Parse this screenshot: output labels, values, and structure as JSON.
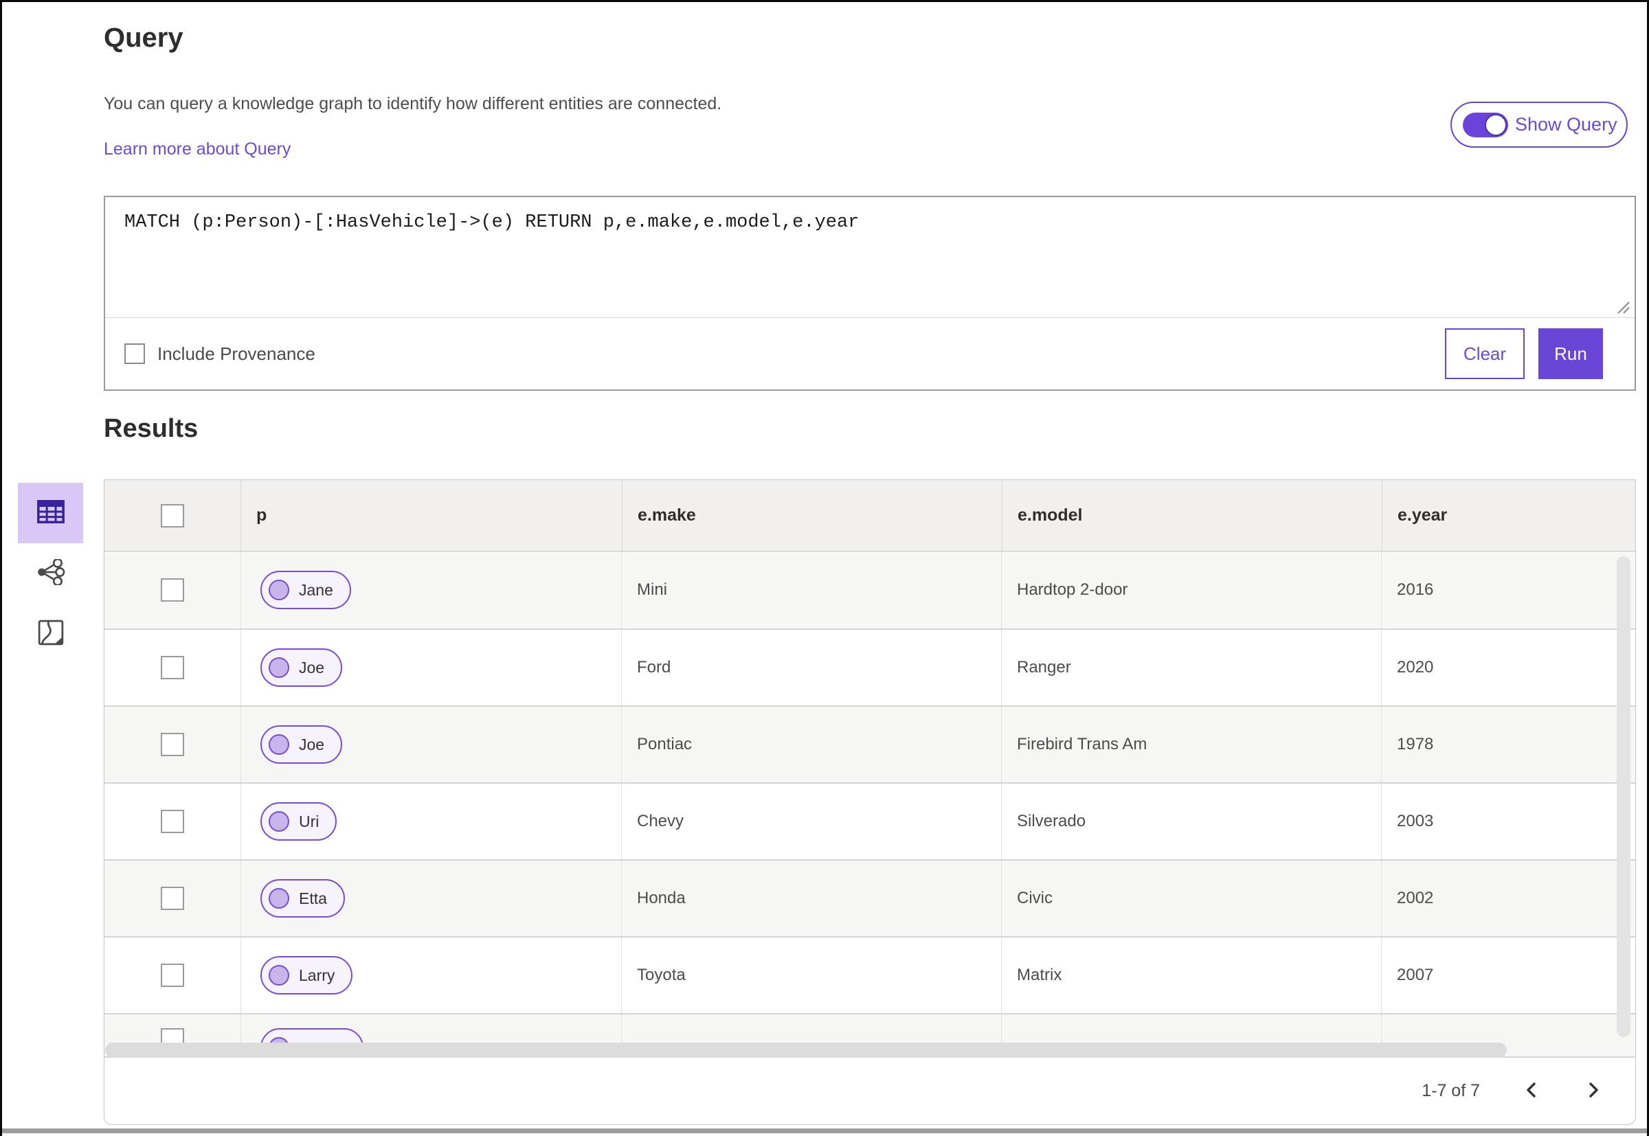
{
  "query_panel": {
    "title": "Query",
    "description": "You can query a knowledge graph to identify how different entities are connected.",
    "learn_more_label": "Learn more about Query",
    "show_query_label": "Show Query",
    "show_query_on": true,
    "query_text": "MATCH (p:Person)-[:HasVehicle]->(e) RETURN p,e.make,e.model,e.year",
    "include_provenance_label": "Include Provenance",
    "include_provenance_checked": false,
    "clear_label": "Clear",
    "run_label": "Run"
  },
  "results": {
    "title": "Results",
    "view_switcher": [
      {
        "name": "table-view",
        "icon": "table-icon",
        "selected": true
      },
      {
        "name": "link-chart-view",
        "icon": "link-chart-icon",
        "selected": false
      },
      {
        "name": "map-view",
        "icon": "map-icon",
        "selected": false
      }
    ],
    "table": {
      "columns": [
        "p",
        "e.make",
        "e.model",
        "e.year"
      ],
      "rows": [
        {
          "p": "Jane",
          "make": "Mini",
          "model": "Hardtop 2-door",
          "year": "2016"
        },
        {
          "p": "Joe",
          "make": "Ford",
          "model": "Ranger",
          "year": "2020"
        },
        {
          "p": "Joe",
          "make": "Pontiac",
          "model": "Firebird Trans Am",
          "year": "1978"
        },
        {
          "p": "Uri",
          "make": "Chevy",
          "model": "Silverado",
          "year": "2003"
        },
        {
          "p": "Etta",
          "make": "Honda",
          "model": "Civic",
          "year": "2002"
        },
        {
          "p": "Larry",
          "make": "Toyota",
          "model": "Matrix",
          "year": "2007"
        }
      ],
      "partial_row_visible": true,
      "pagination": {
        "range_label": "1-7 of 7",
        "prev_icon": "chevron-left-icon",
        "next_icon": "chevron-right-icon"
      }
    }
  },
  "colors": {
    "accent_purple": "#6a44d8",
    "chip_border": "#7a4bd6",
    "chip_bg": "#f6f3fd",
    "chip_dot": "#c7b5ec",
    "selected_view_bg": "#d9c8f5",
    "selected_view_icon": "#38229e",
    "table_header_bg": "#f1f0ef",
    "row_alt_bg": "#f6f6f5",
    "run_button_bg": "#6a46d7"
  }
}
